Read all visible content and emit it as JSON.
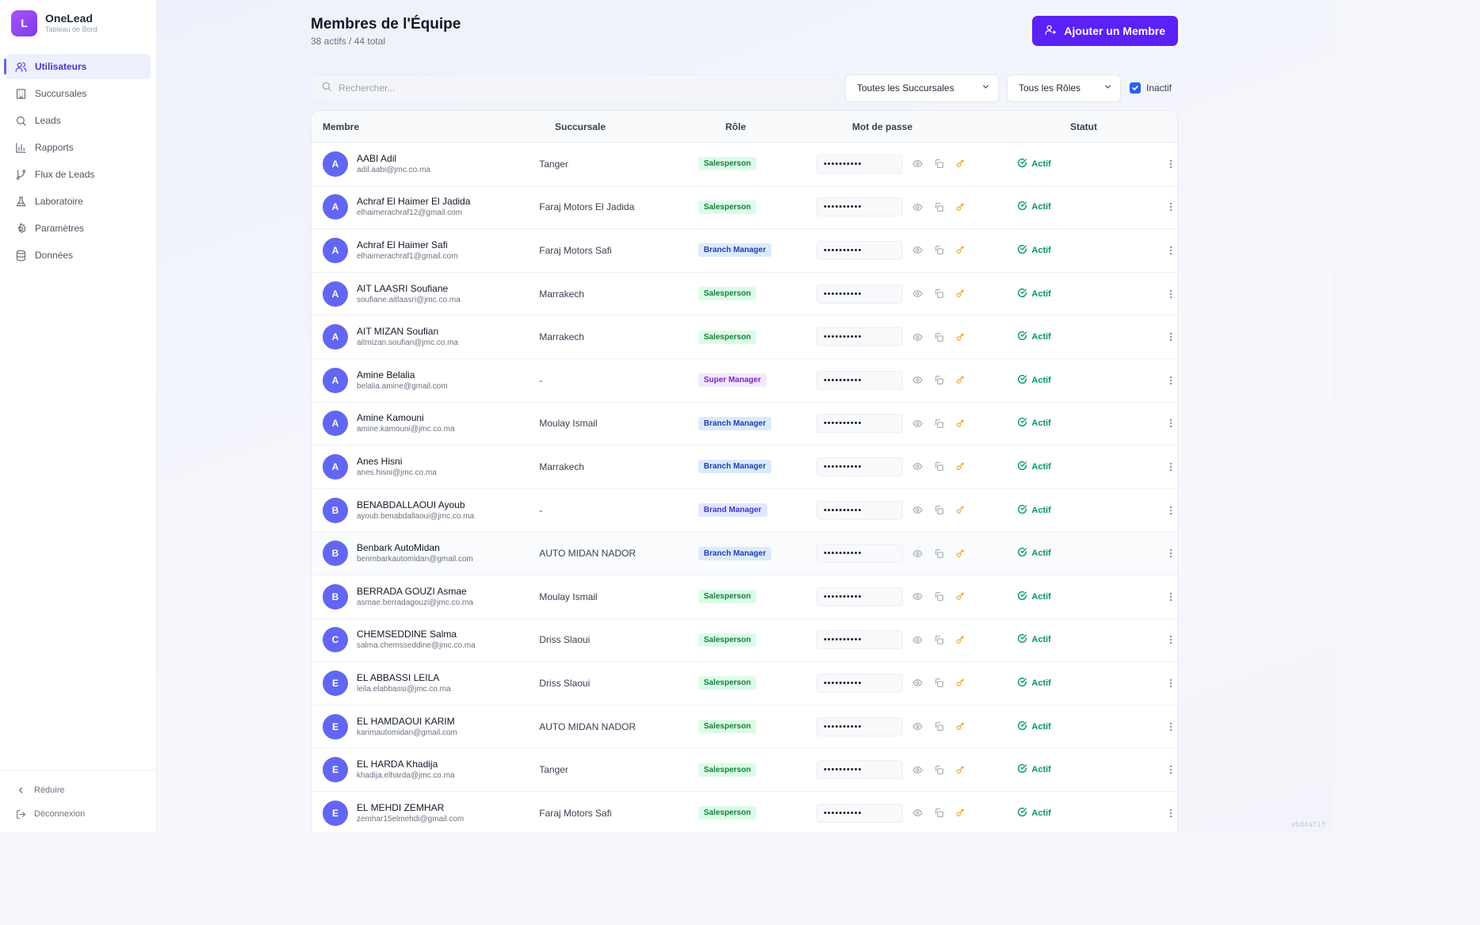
{
  "app": {
    "name": "OneLead",
    "subtitle": "Tableau de Bord",
    "logo_letter": "L",
    "brand_color": "#7c3aed"
  },
  "sidebar": {
    "items": [
      {
        "label": "Utilisateurs",
        "icon": "users-icon",
        "active": true
      },
      {
        "label": "Succursales",
        "icon": "building-icon"
      },
      {
        "label": "Leads",
        "icon": "search-icon"
      },
      {
        "label": "Rapports",
        "icon": "bar-chart-icon"
      },
      {
        "label": "Flux de Leads",
        "icon": "git-branch-icon"
      },
      {
        "label": "Laboratoire",
        "icon": "flask-icon"
      },
      {
        "label": "Paramètres",
        "icon": "gear-icon"
      },
      {
        "label": "Données",
        "icon": "database-icon"
      }
    ],
    "collapse_label": "Réduire",
    "logout_label": "Déconnexion"
  },
  "header": {
    "title": "Membres de l'Équipe",
    "subtitle": "38 actifs / 44 total",
    "add_button": "Ajouter un Membre"
  },
  "filters": {
    "search_placeholder": "Rechercher...",
    "branch_select": "Toutes les Succursales",
    "role_select": "Tous les Rôles",
    "inactive_label": "Inactif",
    "inactive_checked": true
  },
  "table": {
    "columns": [
      "Membre",
      "Succursale",
      "Rôle",
      "Mot de passe",
      "Statut"
    ],
    "password_mask": "••••••••••",
    "rows": [
      {
        "initial": "A",
        "name": "AABI Adil",
        "email": "adil.aabi@jmc.co.ma",
        "branch": "Tanger",
        "role": "Salesperson",
        "status": "Actif"
      },
      {
        "initial": "A",
        "name": "Achraf El Haimer El Jadida",
        "email": "elhaimerachraf12@gmail.com",
        "branch": "Faraj Motors El Jadida",
        "role": "Salesperson",
        "status": "Actif"
      },
      {
        "initial": "A",
        "name": "Achraf El Haimer Safi",
        "email": "elhaimerachraf1@gmail.com",
        "branch": "Faraj Motors Safi",
        "role": "Branch Manager",
        "status": "Actif"
      },
      {
        "initial": "A",
        "name": "AIT LAASRI Soufiane",
        "email": "soufiane.aitlaasri@jmc.co.ma",
        "branch": "Marrakech",
        "role": "Salesperson",
        "status": "Actif"
      },
      {
        "initial": "A",
        "name": "AIT MIZAN Soufian",
        "email": "aitmizan.soufian@jmc.co.ma",
        "branch": "Marrakech",
        "role": "Salesperson",
        "status": "Actif"
      },
      {
        "initial": "A",
        "name": "Amine Belalia",
        "email": "belalia.amine@gmail.com",
        "branch": "-",
        "role": "Super Manager",
        "status": "Actif"
      },
      {
        "initial": "A",
        "name": "Amine Kamouni",
        "email": "amine.kamouni@jmc.co.ma",
        "branch": "Moulay Ismail",
        "role": "Branch Manager",
        "status": "Actif"
      },
      {
        "initial": "A",
        "name": "Anes Hisni",
        "email": "anes.hisni@jmc.co.ma",
        "branch": "Marrakech",
        "role": "Branch Manager",
        "status": "Actif"
      },
      {
        "initial": "B",
        "name": "BENABDALLAOUI Ayoub",
        "email": "ayoub.benabdallaoui@jmc.co.ma",
        "branch": "-",
        "role": "Brand Manager",
        "status": "Actif"
      },
      {
        "initial": "B",
        "name": "Benbark AutoMidan",
        "email": "benmbarkautomidan@gmail.com",
        "branch": "AUTO MIDAN NADOR",
        "role": "Branch Manager",
        "status": "Actif",
        "highlighted": true
      },
      {
        "initial": "B",
        "name": "BERRADA GOUZI Asmae",
        "email": "asmae.berradagouzi@jmc.co.ma",
        "branch": "Moulay Ismail",
        "role": "Salesperson",
        "status": "Actif"
      },
      {
        "initial": "C",
        "name": "CHEMSEDDINE Salma",
        "email": "salma.chemsseddine@jmc.co.ma",
        "branch": "Driss Slaoui",
        "role": "Salesperson",
        "status": "Actif"
      },
      {
        "initial": "E",
        "name": "EL ABBASSI LEILA",
        "email": "leila.elabbassi@jmc.co.ma",
        "branch": "Driss Slaoui",
        "role": "Salesperson",
        "status": "Actif"
      },
      {
        "initial": "E",
        "name": "EL HAMDAOUI KARIM",
        "email": "karimautomidan@gmail.com",
        "branch": "AUTO MIDAN NADOR",
        "role": "Salesperson",
        "status": "Actif"
      },
      {
        "initial": "E",
        "name": "EL HARDA Khadija",
        "email": "khadija.elharda@jmc.co.ma",
        "branch": "Tanger",
        "role": "Salesperson",
        "status": "Actif"
      },
      {
        "initial": "E",
        "name": "EL MEHDI ZEMHAR",
        "email": "zemhar15elmehdi@gmail.com",
        "branch": "Faraj Motors Safi",
        "role": "Salesperson",
        "status": "Actif"
      }
    ]
  },
  "version": "vbd4af1f",
  "colors": {
    "accent": "#5b21f6",
    "active_status": "#059669",
    "avatar": "#6366f1"
  }
}
